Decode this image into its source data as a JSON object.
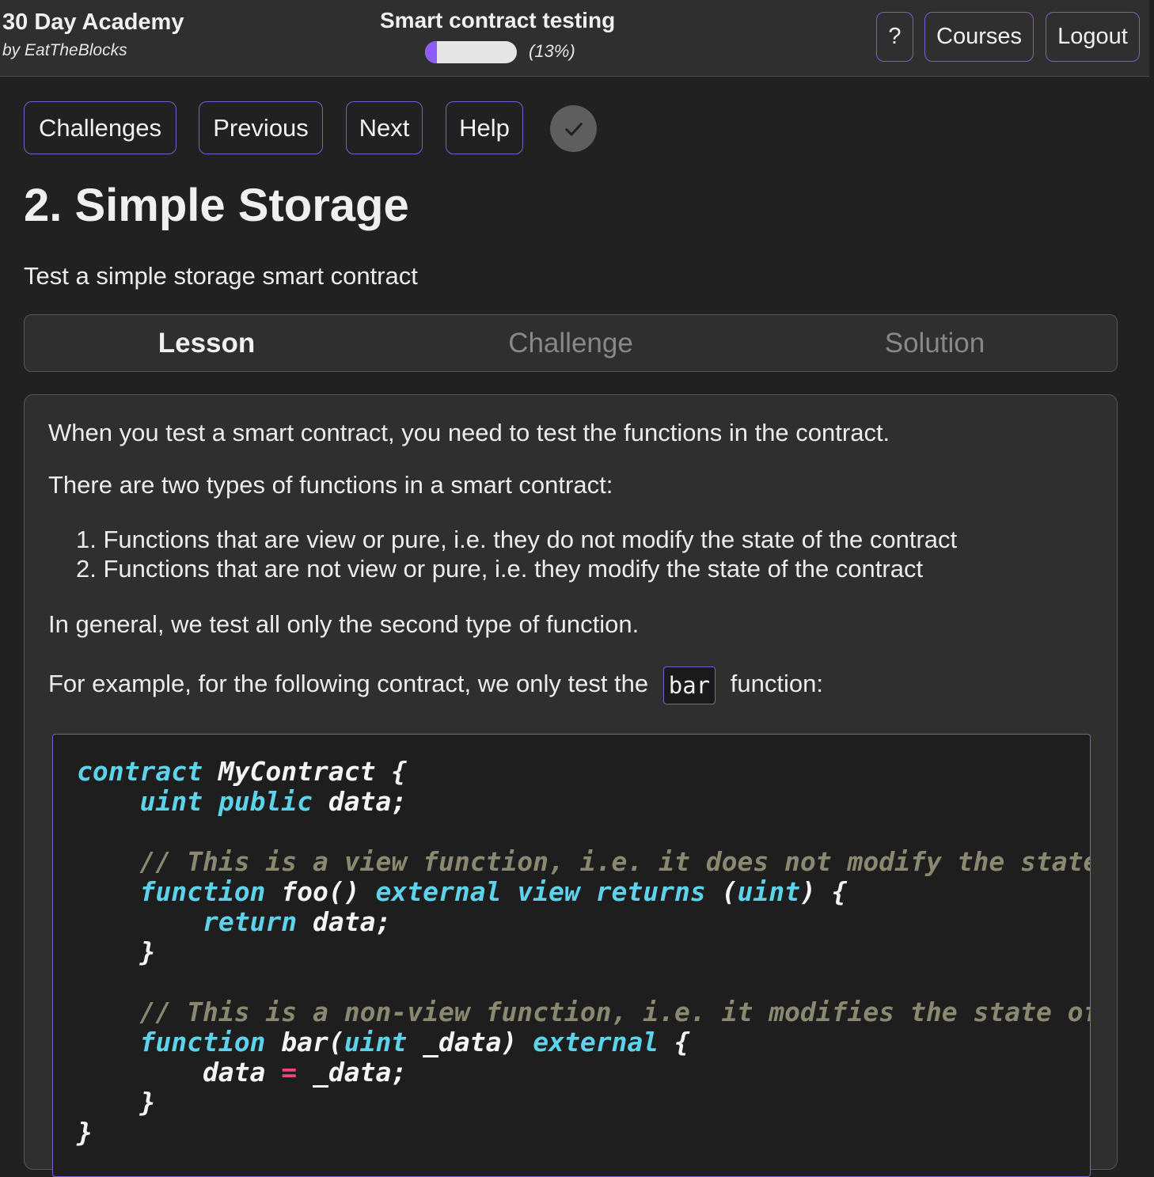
{
  "header": {
    "brand_title": "30 Day Academy",
    "brand_subtitle": "by EatTheBlocks",
    "course_title": "Smart contract testing",
    "progress_percent": 13,
    "progress_label": "(13%)",
    "help_label": "?",
    "courses_label": "Courses",
    "logout_label": "Logout"
  },
  "nav": {
    "challenges_label": "Challenges",
    "previous_label": "Previous",
    "next_label": "Next",
    "help_label": "Help",
    "complete_icon": "check-icon"
  },
  "page": {
    "title": "2. Simple Storage",
    "description": "Test a simple storage smart contract"
  },
  "tabs": [
    {
      "label": "Lesson",
      "active": true
    },
    {
      "label": "Challenge",
      "active": false
    },
    {
      "label": "Solution",
      "active": false
    }
  ],
  "lesson": {
    "p1": "When you test a smart contract, you need to test the functions in the contract.",
    "p2": "There are two types of functions in a smart contract:",
    "list": [
      "Functions that are view or pure, i.e. they do not modify the state of the contract",
      "Functions that are not view or pure, i.e. they modify the state of the contract"
    ],
    "p3": "In general, we test all only the second type of function.",
    "p4_before": "For example, for the following contract, we only test the",
    "p4_code": "bar",
    "p4_after": "function:",
    "code_lines": [
      [
        [
          "kw",
          "contract"
        ],
        [
          "t",
          " MyContract {"
        ]
      ],
      [
        [
          "t",
          "    "
        ],
        [
          "kw",
          "uint public"
        ],
        [
          "t",
          " data;"
        ]
      ],
      [
        [
          "t",
          ""
        ]
      ],
      [
        [
          "t",
          "    "
        ],
        [
          "cm",
          "// This is a view function, i.e. it does not modify the state"
        ]
      ],
      [
        [
          "t",
          "    "
        ],
        [
          "kw",
          "function"
        ],
        [
          "t",
          " foo() "
        ],
        [
          "kw",
          "external view returns"
        ],
        [
          "t",
          " ("
        ],
        [
          "kw",
          "uint"
        ],
        [
          "t",
          ") {"
        ]
      ],
      [
        [
          "t",
          "        "
        ],
        [
          "kw",
          "return"
        ],
        [
          "t",
          " data;"
        ]
      ],
      [
        [
          "t",
          "    }"
        ]
      ],
      [
        [
          "t",
          ""
        ]
      ],
      [
        [
          "t",
          "    "
        ],
        [
          "cm",
          "// This is a non-view function, i.e. it modifies the state of"
        ]
      ],
      [
        [
          "t",
          "    "
        ],
        [
          "kw",
          "function"
        ],
        [
          "t",
          " bar("
        ],
        [
          "kw",
          "uint"
        ],
        [
          "t",
          " _data) "
        ],
        [
          "kw",
          "external"
        ],
        [
          "t",
          " {"
        ]
      ],
      [
        [
          "t",
          "        data "
        ],
        [
          "op",
          "="
        ],
        [
          "t",
          " _data;"
        ]
      ],
      [
        [
          "t",
          "    }"
        ]
      ],
      [
        [
          "t",
          "}"
        ]
      ]
    ]
  },
  "colors": {
    "accent": "#8b5cf6",
    "border_accent": "#7c5ccf",
    "keyword": "#5cd2eb",
    "comment": "#8a8870",
    "operator": "#f0437a"
  }
}
